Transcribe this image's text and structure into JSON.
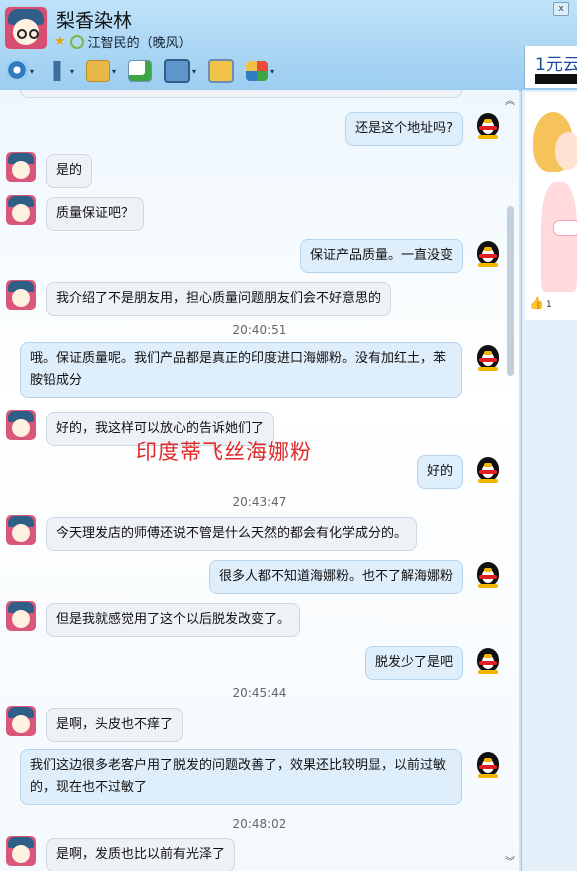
{
  "window": {
    "title": "梨香染林",
    "signature": "江智民的（晚风）",
    "close_glyph": "x"
  },
  "toolbar": {
    "items": [
      {
        "icon": "video-camera-icon"
      },
      {
        "icon": "microphone-icon"
      },
      {
        "icon": "file-transfer-icon"
      },
      {
        "icon": "add-member-icon"
      },
      {
        "icon": "remote-desktop-icon"
      },
      {
        "icon": "share-screen-icon"
      },
      {
        "icon": "apps-icon"
      }
    ]
  },
  "ad": {
    "text": "1元云"
  },
  "side_panel": {
    "like_count": "1"
  },
  "watermark": "印度蒂飞丝海娜粉",
  "messages": [
    {
      "type": "right",
      "text": "还是这个地址吗?"
    },
    {
      "type": "left",
      "text": "是的"
    },
    {
      "type": "left",
      "text": "质量保证吧？"
    },
    {
      "type": "right",
      "text": "保证产品质量。一直没变"
    },
    {
      "type": "left",
      "text": "我介绍了不是朋友用，担心质量问题朋友们会不好意思的"
    },
    {
      "type": "time",
      "text": "20:40:51"
    },
    {
      "type": "right",
      "text": "哦。保证质量呢。我们产品都是真正的印度进口海娜粉。没有加红土，苯胺铅成分"
    },
    {
      "type": "left",
      "text": "好的，我这样可以放心的告诉她们了"
    },
    {
      "type": "right",
      "text": "好的"
    },
    {
      "type": "time",
      "text": "20:43:47"
    },
    {
      "type": "left",
      "text": "今天理发店的师傅还说不管是什么天然的都会有化学成分的。"
    },
    {
      "type": "right",
      "text": "很多人都不知道海娜粉。也不了解海娜粉"
    },
    {
      "type": "left",
      "text": "但是我就感觉用了这个以后脱发改变了。"
    },
    {
      "type": "right",
      "text": "脱发少了是吧"
    },
    {
      "type": "time",
      "text": "20:45:44"
    },
    {
      "type": "left",
      "text": "是啊，头皮也不痒了"
    },
    {
      "type": "right",
      "text": "我们这边很多老客户用了脱发的问题改善了，效果还比较明显，以前过敏的，现在也不过敏了"
    },
    {
      "type": "time",
      "text": "20:48:02"
    },
    {
      "type": "left",
      "text": "是啊，发质也比以前有光泽了"
    }
  ],
  "colors": {
    "accent": "#9ccdf0",
    "watermark": "#e02828"
  }
}
